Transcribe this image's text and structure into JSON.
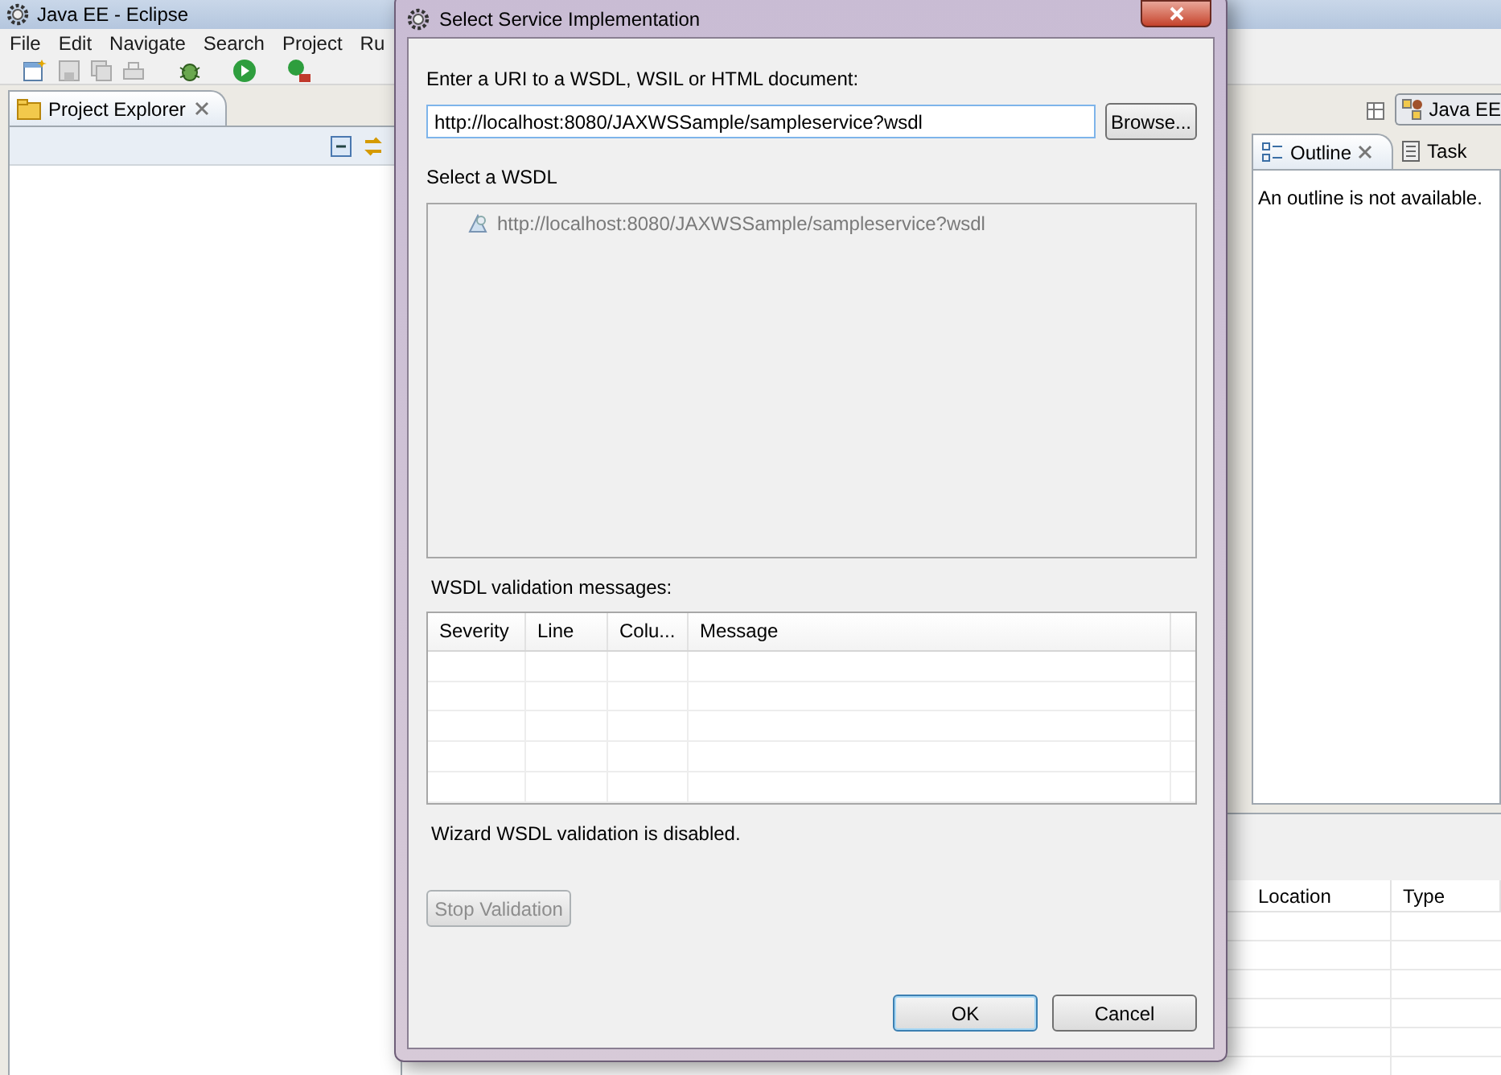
{
  "eclipse": {
    "title": "Java EE - Eclipse",
    "menu": [
      "File",
      "Edit",
      "Navigate",
      "Search",
      "Project",
      "Ru"
    ],
    "perspective": "Java EE",
    "project_explorer": {
      "title": "Project Explorer"
    },
    "outline": {
      "tabs": [
        {
          "label": "Outline",
          "selected": true
        },
        {
          "label": "Task",
          "selected": false
        }
      ],
      "message": "An outline is not available."
    },
    "bottom_table": {
      "columns": [
        "Location",
        "Type"
      ]
    }
  },
  "dialog": {
    "title": "Select Service Implementation",
    "uri_label": "Enter a URI to a WSDL, WSIL or HTML document:",
    "uri_value": "http://localhost:8080/JAXWSSample/sampleservice?wsdl",
    "browse": "Browse...",
    "select_label": "Select a WSDL",
    "wsdl_tree": {
      "disabled": true,
      "items": [
        "http://localhost:8080/JAXWSSample/sampleservice?wsdl"
      ]
    },
    "messages_label": "WSDL validation messages:",
    "messages_table": {
      "columns": [
        "Severity",
        "Line",
        "Colu...",
        "Message"
      ]
    },
    "status": "Wizard WSDL validation is disabled.",
    "stop_button": {
      "label": "Stop Validation",
      "disabled": true
    },
    "buttons": [
      {
        "label": "OK",
        "default": true
      },
      {
        "label": "Cancel",
        "default": false
      }
    ]
  }
}
